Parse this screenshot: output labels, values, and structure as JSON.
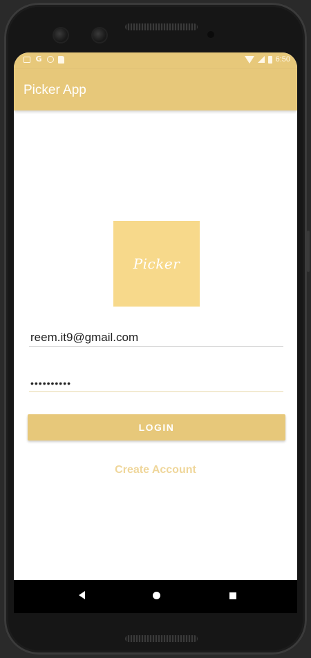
{
  "status_bar": {
    "time": "6:50",
    "left_icons": [
      "image-notification-icon",
      "google-icon",
      "circle-notification-icon",
      "sd-card-icon"
    ],
    "right_icons": [
      "wifi-icon",
      "signal-icon",
      "battery-icon"
    ],
    "google_glyph": "G"
  },
  "app_bar": {
    "title": "Picker App"
  },
  "logo": {
    "text": "Picker"
  },
  "login_form": {
    "email_value": "reem.it9@gmail.com",
    "password_value": "••••••••••",
    "login_label": "LOGIN",
    "create_account_label": "Create Account"
  },
  "nav_bar": {
    "buttons": [
      "back-icon",
      "home-icon",
      "recents-icon"
    ]
  },
  "colors": {
    "accent": "#e7c87a",
    "logo_bg": "#f7d98b",
    "link": "#efd69a"
  }
}
